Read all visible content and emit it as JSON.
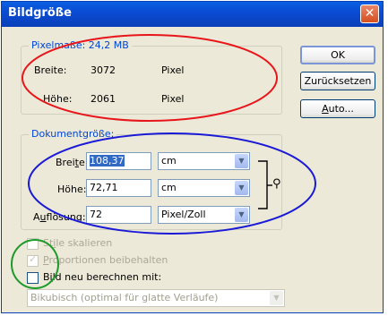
{
  "window": {
    "title": "Bildgröße",
    "close_glyph": "✕"
  },
  "pixel_dims": {
    "legend": "Pixelmaße: 24,2 MB",
    "width_label": "Breite:",
    "width_value": "3072",
    "width_unit": "Pixel",
    "height_label": "Höhe:",
    "height_value": "2061",
    "height_unit": "Pixel"
  },
  "buttons": {
    "ok": "OK",
    "reset": "Zurücksetzen",
    "auto_prefix": "",
    "auto_u": "A",
    "auto_rest": "uto..."
  },
  "document_size": {
    "legend": "Dokumentgröße:",
    "width_label_a": "Brei",
    "width_label_u": "t",
    "width_label_b": "e:",
    "width_value": "108,37",
    "width_unit": "cm",
    "height_label": "Höhe:",
    "height_value": "72,71",
    "height_unit": "cm",
    "res_label_a": "A",
    "res_label_u": "u",
    "res_label_b": "flösung:",
    "res_value": "72",
    "res_unit": "Pixel/Zoll",
    "link_icon": "⚲"
  },
  "options": {
    "scale_styles": {
      "label_a": "St",
      "label_u": "i",
      "label_b": "le skalieren",
      "checked": false,
      "enabled": false
    },
    "constrain": {
      "label_a": "",
      "label_u": "P",
      "label_b": "roportionen beibehalten",
      "checked": true,
      "enabled": false
    },
    "resample": {
      "label_a": "B",
      "label_u": "i",
      "label_b": "ld neu berechnen mit:",
      "checked": false,
      "enabled": true
    },
    "method": {
      "value": "Bikubisch (optimal für glatte Verläufe)",
      "enabled": false
    }
  },
  "annotation_colors": {
    "red": "#e8161b",
    "blue": "#1a1ad6",
    "green": "#1d9a2a"
  }
}
